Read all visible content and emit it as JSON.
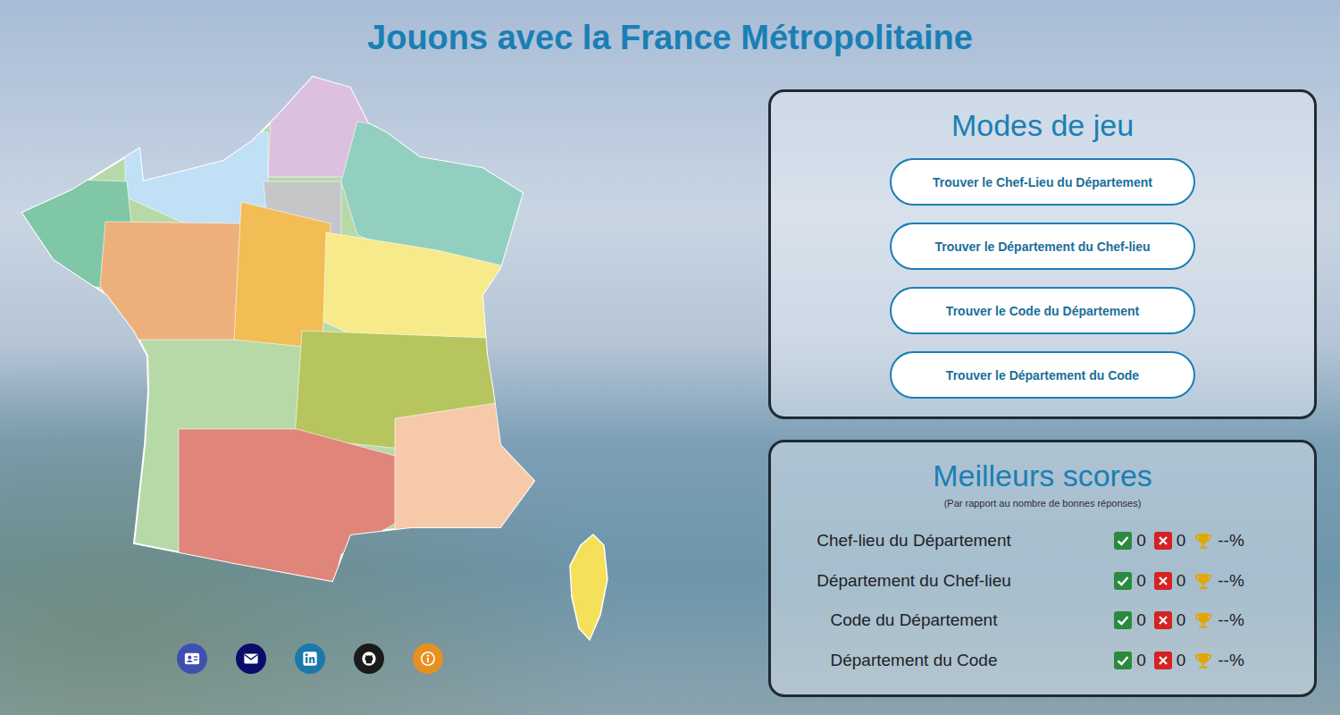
{
  "page": {
    "title": "Jouons avec la France Métropolitaine"
  },
  "modes": {
    "title": "Modes de jeu",
    "buttons": [
      "Trouver le Chef-Lieu du Département",
      "Trouver le Département du Chef-lieu",
      "Trouver le Code du Département",
      "Trouver le Département du Code"
    ]
  },
  "scores": {
    "title": "Meilleurs scores",
    "subtitle": "(Par rapport au nombre de bonnes réponses)",
    "rows": [
      {
        "label": "Chef-lieu du Département",
        "correct": "0",
        "wrong": "0",
        "ratio": "--%"
      },
      {
        "label": "Département du Chef-lieu",
        "correct": "0",
        "wrong": "0",
        "ratio": "--%"
      },
      {
        "label": "Code du Département",
        "correct": "0",
        "wrong": "0",
        "ratio": "--%"
      },
      {
        "label": "Département du Code",
        "correct": "0",
        "wrong": "0",
        "ratio": "--%"
      }
    ]
  },
  "social": [
    {
      "color": "#3f4fb0"
    },
    {
      "color": "#0b0b6b"
    },
    {
      "color": "#1b78ac"
    },
    {
      "color": "#1a1a1a"
    },
    {
      "color": "#e8901f"
    }
  ]
}
